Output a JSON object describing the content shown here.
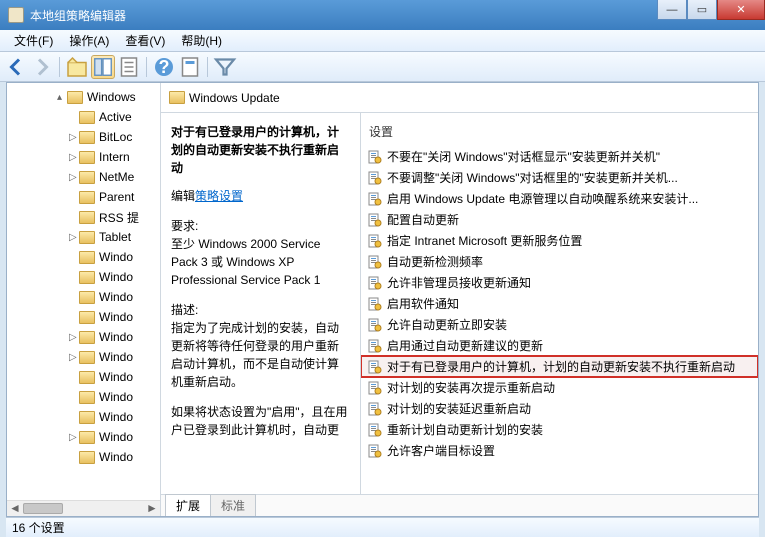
{
  "window": {
    "title": "本地组策略编辑器",
    "close": "✕",
    "max": "▭",
    "min": "—"
  },
  "menu": {
    "file": "文件(F)",
    "action": "操作(A)",
    "view": "查看(V)",
    "help": "帮助(H)"
  },
  "tree": {
    "items": [
      {
        "exp": "▴",
        "label": "Windows"
      },
      {
        "exp": "",
        "label": "Active"
      },
      {
        "exp": "▷",
        "label": "BitLoc"
      },
      {
        "exp": "▷",
        "label": "Intern"
      },
      {
        "exp": "▷",
        "label": "NetMe"
      },
      {
        "exp": "",
        "label": "Parent"
      },
      {
        "exp": "",
        "label": "RSS 提"
      },
      {
        "exp": "▷",
        "label": "Tablet"
      },
      {
        "exp": "",
        "label": "Windo"
      },
      {
        "exp": "",
        "label": "Windo"
      },
      {
        "exp": "",
        "label": "Windo"
      },
      {
        "exp": "",
        "label": "Windo"
      },
      {
        "exp": "▷",
        "label": "Windo"
      },
      {
        "exp": "▷",
        "label": "Windo"
      },
      {
        "exp": "",
        "label": "Windo"
      },
      {
        "exp": "",
        "label": "Windo"
      },
      {
        "exp": "",
        "label": "Windo"
      },
      {
        "exp": "▷",
        "label": "Windo"
      },
      {
        "exp": "",
        "label": "Windo"
      }
    ]
  },
  "right": {
    "header": "Windows Update",
    "desc": {
      "title": "对于有已登录用户的计算机，计划的自动更新安装不执行重新启动",
      "edit_label": "编辑",
      "edit_link": "策略设置",
      "req_label": "要求:",
      "req_text": "至少 Windows 2000 Service Pack 3 或 Windows XP Professional Service Pack 1",
      "desc_label": "描述:",
      "desc_text1": "指定为了完成计划的安装，自动更新将等待任何登录的用户重新启动计算机，而不是自动使计算机重新启动。",
      "desc_text2": "如果将状态设置为\"启用\"，且在用户已登录到此计算机时，自动更"
    },
    "settings_header": "设置",
    "settings": [
      "不要在\"关闭 Windows\"对话框显示\"安装更新并关机\"",
      "不要调整\"关闭 Windows\"对话框里的\"安装更新并关机...",
      "启用 Windows Update 电源管理以自动唤醒系统来安装计...",
      "配置自动更新",
      "指定 Intranet Microsoft 更新服务位置",
      "自动更新检测频率",
      "允许非管理员接收更新通知",
      "启用软件通知",
      "允许自动更新立即安装",
      "启用通过自动更新建议的更新",
      "对于有已登录用户的计算机，计划的自动更新安装不执行重新启动",
      "对计划的安装再次提示重新启动",
      "对计划的安装延迟重新启动",
      "重新计划自动更新计划的安装",
      "允许客户端目标设置"
    ],
    "highlighted_index": 10,
    "tabs": {
      "ext": "扩展",
      "std": "标准"
    }
  },
  "status": "16 个设置"
}
